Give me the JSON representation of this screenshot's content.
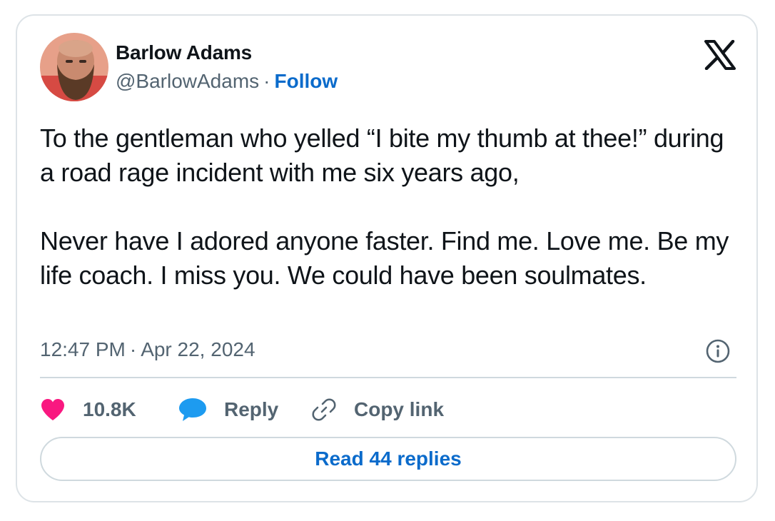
{
  "author": {
    "name": "Barlow Adams",
    "handle": "@BarlowAdams",
    "separator": "·",
    "follow_label": "Follow"
  },
  "tweet": {
    "paragraphs": [
      "To the gentleman who yelled “I bite my thumb at thee!” during a road rage incident with me six years ago,",
      "Never have I adored anyone faster. Find me. Love me. Be my life coach. I miss you. We could have been soulmates."
    ],
    "time": "12:47 PM",
    "separator": "·",
    "date": "Apr 22, 2024"
  },
  "actions": {
    "like_count": "10.8K",
    "reply_label": "Reply",
    "copy_link_label": "Copy link"
  },
  "read_replies_label": "Read 44 replies",
  "icons": {
    "brand": "x-logo-icon",
    "info": "info-icon",
    "like": "heart-icon",
    "reply": "speech-bubble-icon",
    "copy": "link-icon"
  },
  "colors": {
    "accent": "#0b6bcb",
    "like": "#f91880",
    "reply": "#1d9bf0",
    "muted": "#536471",
    "text": "#0f1419",
    "border": "#cfd9de"
  }
}
